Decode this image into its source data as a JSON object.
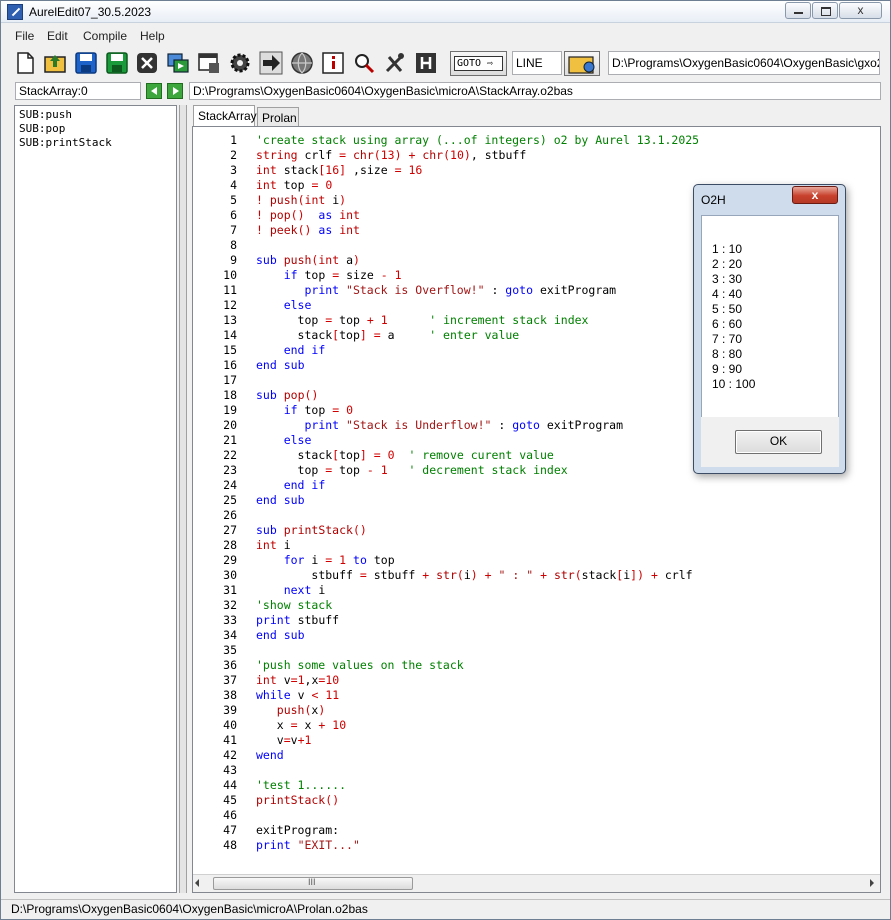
{
  "window": {
    "title": "AurelEdit07_30.5.2023",
    "close_label": "x"
  },
  "menubar": {
    "items": [
      "File",
      "Edit",
      "Compile",
      "Help"
    ]
  },
  "toolbar": {
    "icons": [
      "new-file-icon",
      "open-folder-icon",
      "save-icon",
      "save-as-icon",
      "close-file-icon",
      "run-icon",
      "compile-icon",
      "settings-gear-icon",
      "go-arrow-icon",
      "globe-icon",
      "info-icon",
      "search-icon",
      "tools-icon",
      "help-h-icon"
    ],
    "goto_label": "GOTO",
    "line_input_value": "LINE",
    "compiler_path": "D:\\Programs\\OxygenBasic0604\\OxygenBasic\\gxo2.exe"
  },
  "nav": {
    "sub_combo_value": "StackArray:0",
    "file_path": "D:\\Programs\\OxygenBasic0604\\OxygenBasic\\microA\\StackArray.o2bas"
  },
  "sub_list": {
    "items": [
      "SUB:push",
      "SUB:pop",
      "SUB:printStack"
    ]
  },
  "tabs": {
    "items": [
      "StackArray",
      "Prolan"
    ],
    "active": "StackArray"
  },
  "editor": {
    "line_numbers": [
      "1",
      "2",
      "3",
      "4",
      "5",
      "6",
      "7",
      "8",
      "9",
      "10",
      "11",
      "12",
      "13",
      "14",
      "15",
      "16",
      "17",
      "18",
      "19",
      "20",
      "21",
      "22",
      "23",
      "24",
      "25",
      "26",
      "27",
      "28",
      "29",
      "30",
      "31",
      "32",
      "33",
      "34",
      "35",
      "36",
      "37",
      "38",
      "39",
      "40",
      "41",
      "42",
      "43",
      "44",
      "45",
      "46",
      "47",
      "48"
    ],
    "code_lines": [
      "'create stack using array (...of integers) o2 by Aurel 13.1.2025",
      "string crlf = chr(13) + chr(10), stbuff",
      "int stack[16] ,size = 16",
      "int top = 0",
      "! push(int i)",
      "! pop()  as int",
      "! peek() as int",
      "",
      "sub push(int a)",
      "    if top = size - 1",
      "       print \"Stack is Overflow!\" : goto exitProgram",
      "    else",
      "      top = top + 1      ' increment stack index",
      "      stack[top] = a     ' enter value",
      "    end if",
      "end sub",
      "",
      "sub pop()",
      "    if top = 0",
      "       print \"Stack is Underflow!\" : goto exitProgram",
      "    else",
      "      stack[top] = 0  ' remove curent value",
      "      top = top - 1   ' decrement stack index",
      "    end if",
      "end sub",
      "",
      "sub printStack()",
      "int i",
      "    for i = 1 to top",
      "        stbuff = stbuff + str(i) + \" : \" + str(stack[i]) + crlf",
      "    next i",
      "'show stack",
      "print stbuff",
      "end sub",
      "",
      "'push some values on the stack",
      "int v=1,x=10",
      "while v < 11",
      "   push(x)",
      "   x = x + 10",
      "   v=v+1",
      "wend",
      "",
      "'test 1......",
      "printStack()",
      "",
      "exitProgram:",
      "print \"EXIT...\""
    ],
    "scroll_thumb_label": "III"
  },
  "statusbar": {
    "text": "D:\\Programs\\OxygenBasic0604\\OxygenBasic\\microA\\Prolan.o2bas"
  },
  "dialog": {
    "title": "O2H",
    "close_label": "x",
    "lines": [
      "1 : 10",
      "2 : 20",
      "3 : 30",
      "4 : 40",
      "5 : 50",
      "6 : 60",
      "7 : 70",
      "8 : 80",
      "9 : 90",
      "10 : 100"
    ],
    "ok_label": "OK"
  },
  "colors": {
    "comment": "#008000",
    "keyword": "#0000ff",
    "type": "#c00000",
    "number": "#d00000",
    "dialog_close": "#c8412c"
  }
}
